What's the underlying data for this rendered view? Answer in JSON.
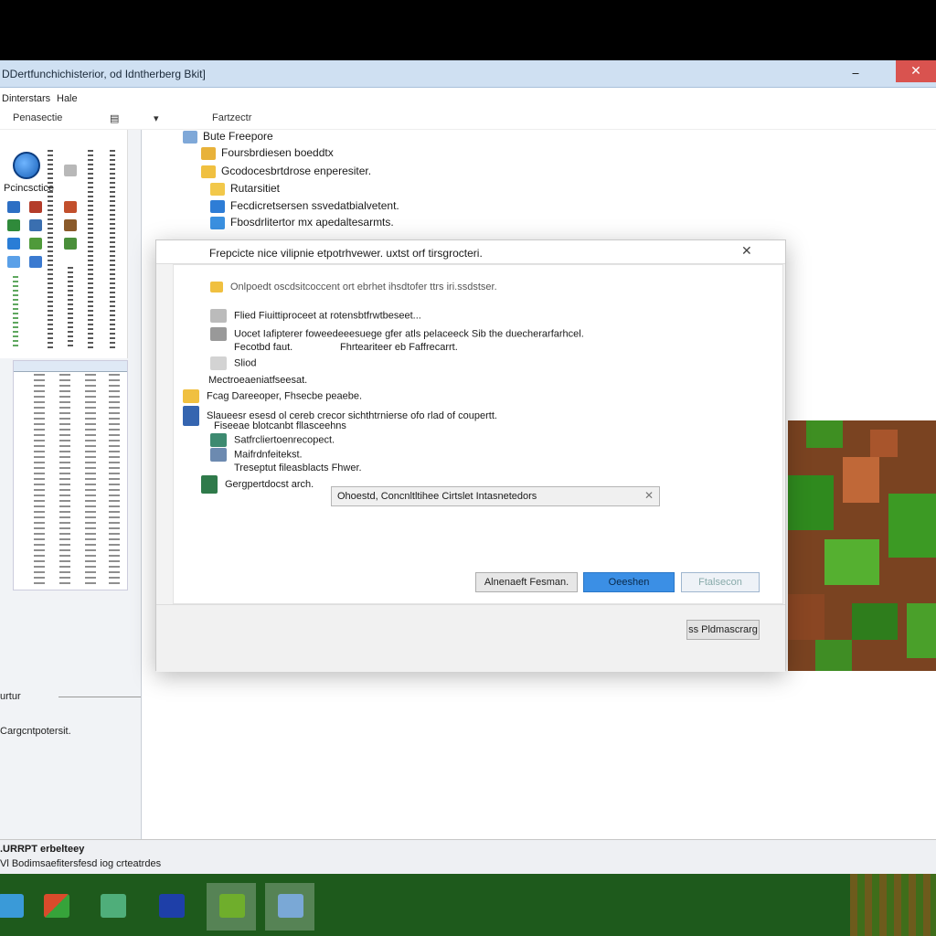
{
  "window": {
    "title": "DDertfunchichisterior, od Idntherberg Bkit]",
    "min_glyph": "⎯",
    "close_glyph": "✕"
  },
  "menu": [
    "Dinterstars",
    "Hale"
  ],
  "toolbar": {
    "left": "Penasectie",
    "mid": "Fartzectr"
  },
  "left_pane": {
    "section_label": "Pcincsctice",
    "divider_label": "urtur",
    "footer_text": "Cargcntpotersit."
  },
  "file_list": [
    {
      "label": "Bute Freepore"
    },
    {
      "label": "Foursbrdiesen boeddtx"
    },
    {
      "label": "Gcodocesbrtdrose enperesiter."
    },
    {
      "label": "Rutarsitiet"
    },
    {
      "label": "Fecdicretsersen ssvedatbialvetent."
    },
    {
      "label": "Fbosdrlitertor mx apedaltesarmts."
    }
  ],
  "dialog": {
    "title": "Frepcicte nice vilipnie etpotrhvewer. uxtst orf tirsgrocteri.",
    "close_glyph": "✕",
    "info_line": "Onlpoedt oscdsitcoccent ort ebrhet ihsdtofer ttrs iri.ssdstser.",
    "items": [
      {
        "label": "Flied Fiuittiproceet at rotensbtfrwtbeseet..."
      },
      {
        "label": "Uocet Iafipterer foweedeeesuege gfer atls pelaceeck Sib the duecherarfarhcel."
      },
      {
        "label": "Fecotbd faut."
      },
      {
        "label": "Sliod"
      },
      {
        "label": "Mectroeaeniatfseesat."
      },
      {
        "label": "Fcag Dareeoper, Fhsecbe peaebe."
      },
      {
        "label": "Slaueesr esesd ol cereb crecor sichthtrnierse ofo rlad of coupertt."
      },
      {
        "label": "Fiseeae blotcanbt fllasceehns"
      },
      {
        "label": "Satfrcliertoenrecopect."
      },
      {
        "label": "Maifrdnfeitekst."
      },
      {
        "label": "Treseptut fileasblacts Fhwer."
      },
      {
        "label": "Gergpertdocst arch."
      }
    ],
    "side_text": "Fhrteariteer eb Faffrecarrt.",
    "input_value": "Ohoestd, Concnltltihee Cirtslet Intasnetedors",
    "clear_glyph": "✕",
    "buttons": {
      "secondary": "Alnenaeft Fesman.",
      "primary": "Oeeshen",
      "disabled": "Ftalsecon"
    },
    "footer_button": "ss Pldmascrarg"
  },
  "status": {
    "line1": ".URRPT erbelteey",
    "line2": "Vl Bodimsaefitersfesd iog crteatrdes"
  },
  "colors": {
    "accent": "#3b8fe5",
    "titlebar": "#cfe0f2",
    "close": "#d9534f",
    "taskbar": "#1e5a1c"
  }
}
